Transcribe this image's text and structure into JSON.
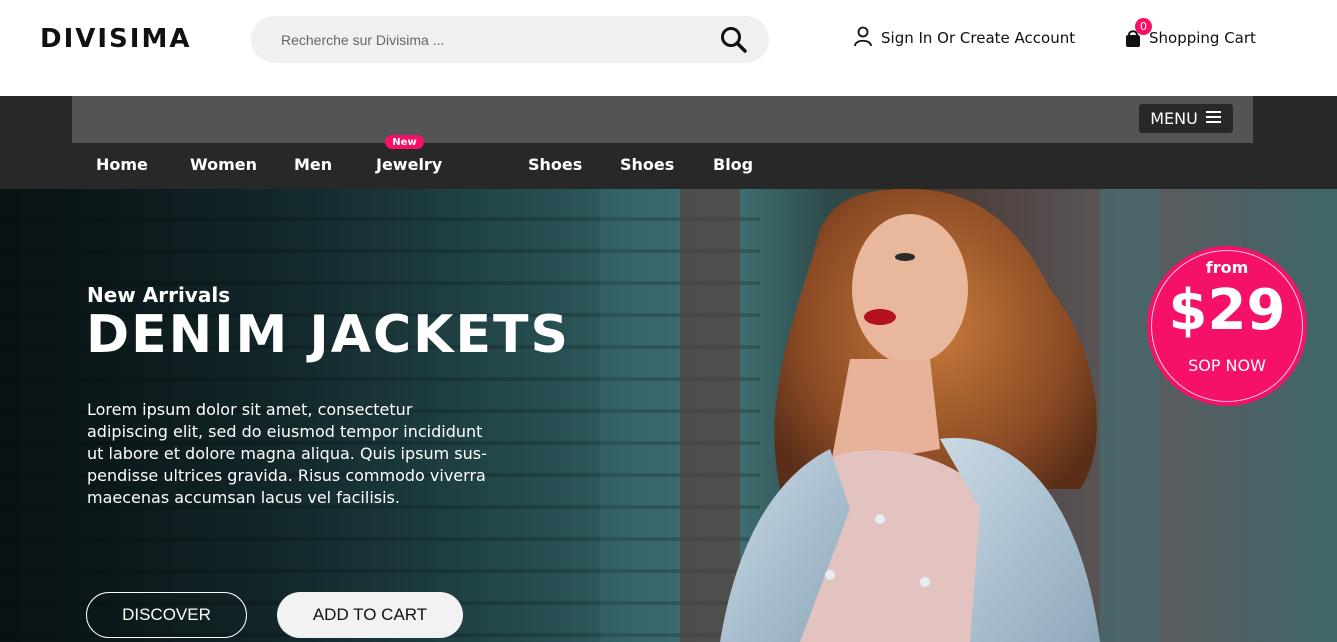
{
  "header": {
    "logo": "DIVISIMA",
    "search_placeholder": "Recherche sur Divisima ...",
    "account_label": "Sign In Or Create Account",
    "cart_label": "Shopping Cart",
    "cart_count": "0"
  },
  "nav": {
    "menu_label": "MENU",
    "items": [
      "Home",
      "Women",
      "Men",
      "Jewelry",
      "Shoes",
      "Shoes",
      "Blog"
    ],
    "new_badge": "New"
  },
  "hero": {
    "subtitle": "New Arrivals",
    "title": "DENIM JACKETS",
    "text": "Lorem ipsum dolor sit amet, consectetur adipiscing elit, sed do eiusmod tempor incididunt ut labore et dolore magna aliqua. Quis ipsum sus-pendisse ultrices gravida. Risus commodo viverra maecenas accumsan lacus vel facilisis.",
    "discover_label": "DISCOVER",
    "add_to_cart_label": "ADD TO CART",
    "price_from": "from",
    "price_amount": "$29",
    "price_cta": "SOP NOW"
  },
  "colors": {
    "accent": "#f51167",
    "nav_bg": "#282828",
    "nav_top_bg": "#545454"
  }
}
